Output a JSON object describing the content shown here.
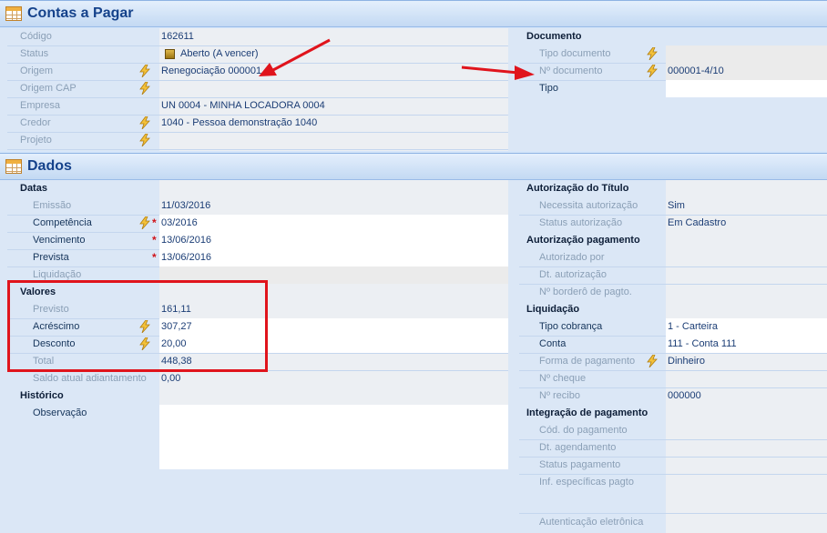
{
  "contas": {
    "title": "Contas a Pagar",
    "left": [
      {
        "label": "Código",
        "value": "162611"
      },
      {
        "label": "Status",
        "value": "Aberto (A vencer)"
      },
      {
        "label": "Origem",
        "value": "Renegociação 000001"
      },
      {
        "label": "Origem CAP",
        "value": ""
      },
      {
        "label": "Empresa",
        "value": "UN 0004 - MINHA LOCADORA 0004"
      },
      {
        "label": "Credor",
        "value": "1040 - Pessoa demonstração 1040"
      },
      {
        "label": "Projeto",
        "value": ""
      }
    ],
    "documento": {
      "group": "Documento",
      "rows": [
        {
          "label": "Tipo documento",
          "value": ""
        },
        {
          "label": "Nº documento",
          "value": "000001-4/10"
        },
        {
          "label": "Tipo",
          "value": ""
        }
      ]
    }
  },
  "dados": {
    "title": "Dados",
    "datas": {
      "group": "Datas",
      "rows": [
        {
          "label": "Emissão",
          "value": "11/03/2016"
        },
        {
          "label": "Competência",
          "value": "03/2016"
        },
        {
          "label": "Vencimento",
          "value": "13/06/2016"
        },
        {
          "label": "Prevista",
          "value": "13/06/2016"
        },
        {
          "label": "Liquidação",
          "value": ""
        }
      ]
    },
    "valores": {
      "group": "Valores",
      "rows": [
        {
          "label": "Previsto",
          "value": "161,11"
        },
        {
          "label": "Acréscimo",
          "value": "307,27"
        },
        {
          "label": "Desconto",
          "value": "20,00"
        },
        {
          "label": "Total",
          "value": "448,38"
        },
        {
          "label": "Saldo atual adiantamento",
          "value": "0,00"
        }
      ]
    },
    "historico": {
      "group": "Histórico",
      "rows": [
        {
          "label": "Observação",
          "value": ""
        }
      ]
    },
    "autorizacao_titulo": {
      "group": "Autorização do Título",
      "rows": [
        {
          "label": "Necessita autorização",
          "value": "Sim"
        },
        {
          "label": "Status autorização",
          "value": "Em Cadastro"
        }
      ]
    },
    "autorizacao_pagamento": {
      "group": "Autorização pagamento",
      "rows": [
        {
          "label": "Autorizado por",
          "value": ""
        },
        {
          "label": "Dt. autorização",
          "value": ""
        },
        {
          "label": "Nº borderô de pagto.",
          "value": ""
        }
      ]
    },
    "liquidacao": {
      "group": "Liquidação",
      "rows": [
        {
          "label": "Tipo cobrança",
          "value": "1 - Carteira"
        },
        {
          "label": "Conta",
          "value": "111 - Conta 111"
        },
        {
          "label": "Forma de pagamento",
          "value": "Dinheiro"
        },
        {
          "label": "Nº cheque",
          "value": ""
        },
        {
          "label": "Nº recibo",
          "value": "000000"
        }
      ]
    },
    "integracao": {
      "group": "Integração de pagamento",
      "rows": [
        {
          "label": "Cód. do pagamento",
          "value": ""
        },
        {
          "label": "Dt. agendamento",
          "value": ""
        },
        {
          "label": "Status pagamento",
          "value": ""
        },
        {
          "label": "Inf. específicas pagto",
          "value": ""
        },
        {
          "label": "Autenticação eletrônica",
          "value": ""
        }
      ]
    }
  },
  "icons": {
    "bolt": "lightning-bolt-icon",
    "grid": "grid-table-icon",
    "status": "status-square-icon",
    "required": "*"
  },
  "colors": {
    "annotation_red": "#e0141c",
    "header_text": "#15428b",
    "required_star": "#d0141a"
  }
}
